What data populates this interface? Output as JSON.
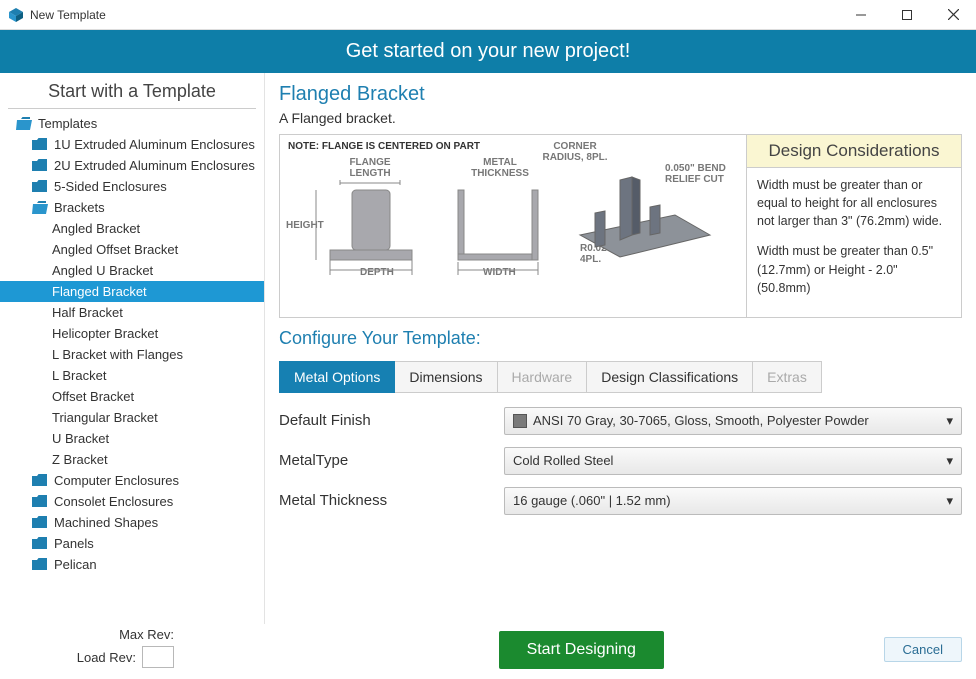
{
  "window": {
    "title": "New Template"
  },
  "banner": "Get started on your new project!",
  "sidebar": {
    "title": "Start with a Template",
    "root": "Templates",
    "folders_before": [
      "1U Extruded Aluminum Enclosures",
      "2U Extruded Aluminum Enclosures",
      "5-Sided Enclosures"
    ],
    "brackets_label": "Brackets",
    "brackets": [
      "Angled Bracket",
      "Angled Offset Bracket",
      "Angled U Bracket",
      "Flanged Bracket",
      "Half Bracket",
      "Helicopter Bracket",
      "L Bracket with Flanges",
      "L Bracket",
      "Offset Bracket",
      "Triangular Bracket",
      "U Bracket",
      "Z Bracket"
    ],
    "selected_index": 3,
    "folders_after": [
      "Computer Enclosures",
      "Consolet Enclosures",
      "Machined Shapes",
      "Panels",
      "Pelican"
    ]
  },
  "part": {
    "title": "Flanged Bracket",
    "desc": "A Flanged bracket."
  },
  "diagram": {
    "note": "NOTE: FLANGE IS CENTERED ON PART",
    "flange_length": "FLANGE LENGTH",
    "metal_thickness": "METAL THICKNESS",
    "corner_radius": "CORNER RADIUS, 8PL.",
    "bend_relief": "0.050\" BEND RELIEF CUT",
    "height": "HEIGHT",
    "depth": "DEPTH",
    "width": "WIDTH",
    "r0020": "R0.020\" 4PL."
  },
  "design_considerations": {
    "title": "Design Considerations",
    "p1": "Width must be greater than or equal to height for all enclosures not larger than 3\" (76.2mm) wide.",
    "p2": "Width must be greater than 0.5\" (12.7mm) or Height - 2.0\" (50.8mm)"
  },
  "configure_title": "Configure Your Template:",
  "tabs": [
    {
      "label": "Metal Options",
      "state": "active"
    },
    {
      "label": "Dimensions",
      "state": "normal"
    },
    {
      "label": "Hardware",
      "state": "disabled"
    },
    {
      "label": "Design Classifications",
      "state": "normal"
    },
    {
      "label": "Extras",
      "state": "disabled"
    }
  ],
  "form": {
    "finish_label": "Default Finish",
    "finish_value": "ANSI 70 Gray, 30-7065, Gloss, Smooth, Polyester Powder",
    "type_label": "MetalType",
    "type_value": "Cold Rolled Steel",
    "thickness_label": "Metal Thickness",
    "thickness_value": "16 gauge (.060\" | 1.52 mm)"
  },
  "footer": {
    "max_rev": "Max Rev:",
    "load_rev": "Load Rev:",
    "start": "Start Designing",
    "cancel": "Cancel"
  }
}
